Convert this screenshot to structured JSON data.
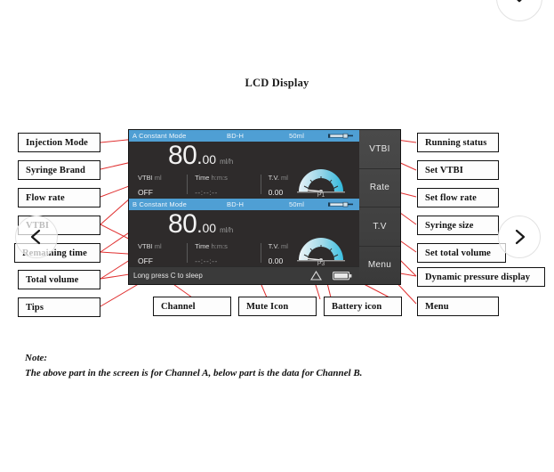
{
  "page": {
    "title": "LCD Display",
    "background": "#ffffff"
  },
  "note": {
    "heading": "Note:",
    "body": "The above part in the screen is for Channel A, below part is the data for Channel B."
  },
  "callouts": {
    "left": [
      {
        "label": "Injection Mode",
        "name": "callout-injection-mode"
      },
      {
        "label": "Syringe Brand",
        "name": "callout-syringe-brand"
      },
      {
        "label": "Flow rate",
        "name": "callout-flow-rate"
      },
      {
        "label": "VTBI",
        "name": "callout-vtbi"
      },
      {
        "label": "Remaining time",
        "name": "callout-remaining-time"
      },
      {
        "label": "Total volume",
        "name": "callout-total-volume"
      },
      {
        "label": "Tips",
        "name": "callout-tips"
      }
    ],
    "right": [
      {
        "label": "Running status",
        "name": "callout-running-status"
      },
      {
        "label": "Set VTBI",
        "name": "callout-set-vtbi"
      },
      {
        "label": "Set flow rate",
        "name": "callout-set-flow-rate"
      },
      {
        "label": "Syringe size",
        "name": "callout-syringe-size"
      },
      {
        "label": "Set total volume",
        "name": "callout-set-total-volume"
      },
      {
        "label": "Dynamic pressure display",
        "name": "callout-dynamic-pressure-display"
      },
      {
        "label": "Menu",
        "name": "callout-menu"
      }
    ],
    "bottom": [
      {
        "label": "Channel",
        "name": "callout-channel"
      },
      {
        "label": "Mute Icon",
        "name": "callout-mute-icon"
      },
      {
        "label": "Battery icon",
        "name": "callout-battery-icon"
      },
      {
        "label": "Menu",
        "name": "callout-menu-bottom"
      }
    ]
  },
  "lcd": {
    "colors": {
      "topbar": "#4f9fd4",
      "body": "#2e2b2b",
      "bottombar": "#3a3a3a",
      "side": "#3f3f3f",
      "gauge_fill": "#4fc3e0",
      "text": "#f2f2f2"
    },
    "channels": [
      {
        "id": "a",
        "mode": "A Constant Mode",
        "brand": "BD-H",
        "size": "50ml",
        "syringe_icon": "syringe-icon",
        "rate_whole": "80",
        "rate_dot": ".",
        "rate_frac": "00",
        "rate_unit": "ml/h",
        "vtbi_label": "VTBI",
        "vtbi_unit": "ml",
        "vtbi_value": "OFF",
        "time_label": "Time",
        "time_unit": "h:m:s",
        "time_value": "--:--:--",
        "tv_label": "T.V.",
        "tv_unit": "ml",
        "tv_value": "0.00",
        "pressure_label": "P1"
      },
      {
        "id": "b",
        "mode": "B Constant Mode",
        "brand": "BD-H",
        "size": "50ml",
        "syringe_icon": "syringe-icon",
        "rate_whole": "80",
        "rate_dot": ".",
        "rate_frac": "00",
        "rate_unit": "ml/h",
        "vtbi_label": "VTBI",
        "vtbi_unit": "ml",
        "vtbi_value": "OFF",
        "time_label": "Time",
        "time_unit": "h:m:s",
        "time_value": "--:--:--",
        "tv_label": "T.V.",
        "tv_unit": "ml",
        "tv_value": "0.00",
        "pressure_label": "P3"
      }
    ],
    "side_buttons": [
      {
        "label": "VTBI",
        "name": "lcd-side-button-vtbi"
      },
      {
        "label": "Rate",
        "name": "lcd-side-button-rate"
      },
      {
        "label": "T.V",
        "name": "lcd-side-button-tv"
      },
      {
        "label": "Menu",
        "name": "lcd-side-button-menu"
      }
    ],
    "bottom_bar": {
      "tip": "Long press C to sleep",
      "mute_icon": "mute-icon",
      "battery_icon": "battery-icon"
    }
  },
  "nav": {
    "prev_icon": "chevron-left-icon",
    "next_icon": "chevron-right-icon",
    "top_icon": "chevron-down-icon"
  }
}
